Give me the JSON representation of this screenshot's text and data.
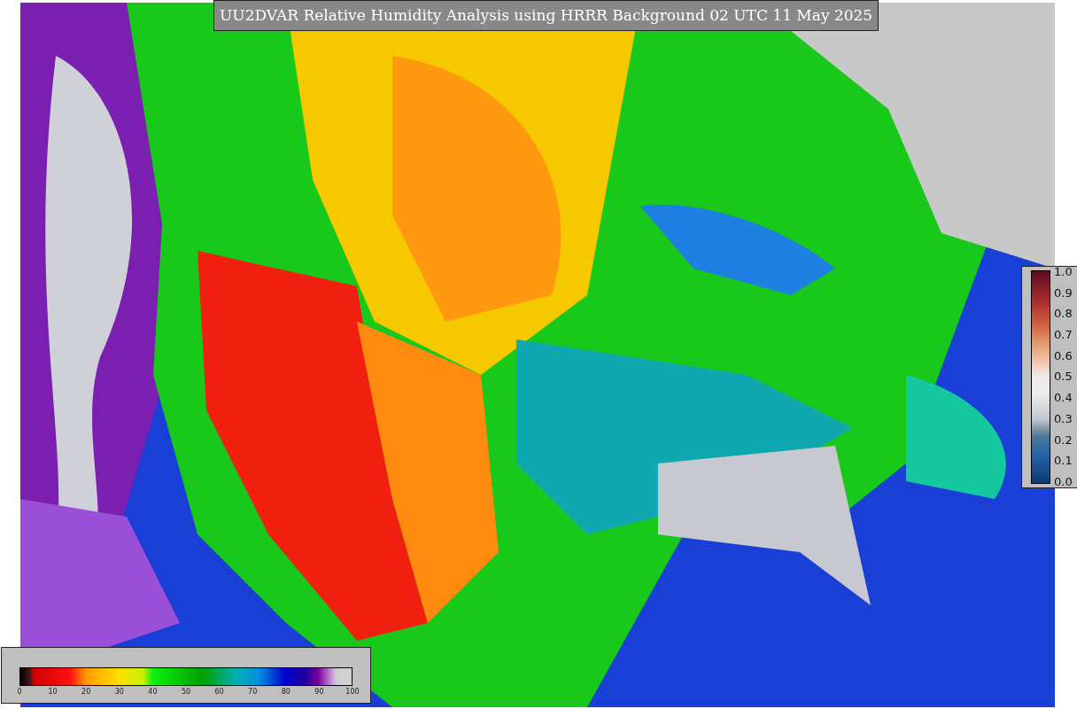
{
  "title": "UU2DVAR Relative Humidity Analysis using HRRR Background 02 UTC 11 May 2025",
  "humidity_colorbar": {
    "ticks": [
      "0",
      "10",
      "20",
      "30",
      "40",
      "50",
      "60",
      "70",
      "80",
      "90",
      "100"
    ]
  },
  "fraction_colorbar": {
    "ticks": [
      "1.0",
      "0.9",
      "0.8",
      "0.7",
      "0.6",
      "0.5",
      "0.4",
      "0.3",
      "0.2",
      "0.1",
      "0.0"
    ]
  }
}
